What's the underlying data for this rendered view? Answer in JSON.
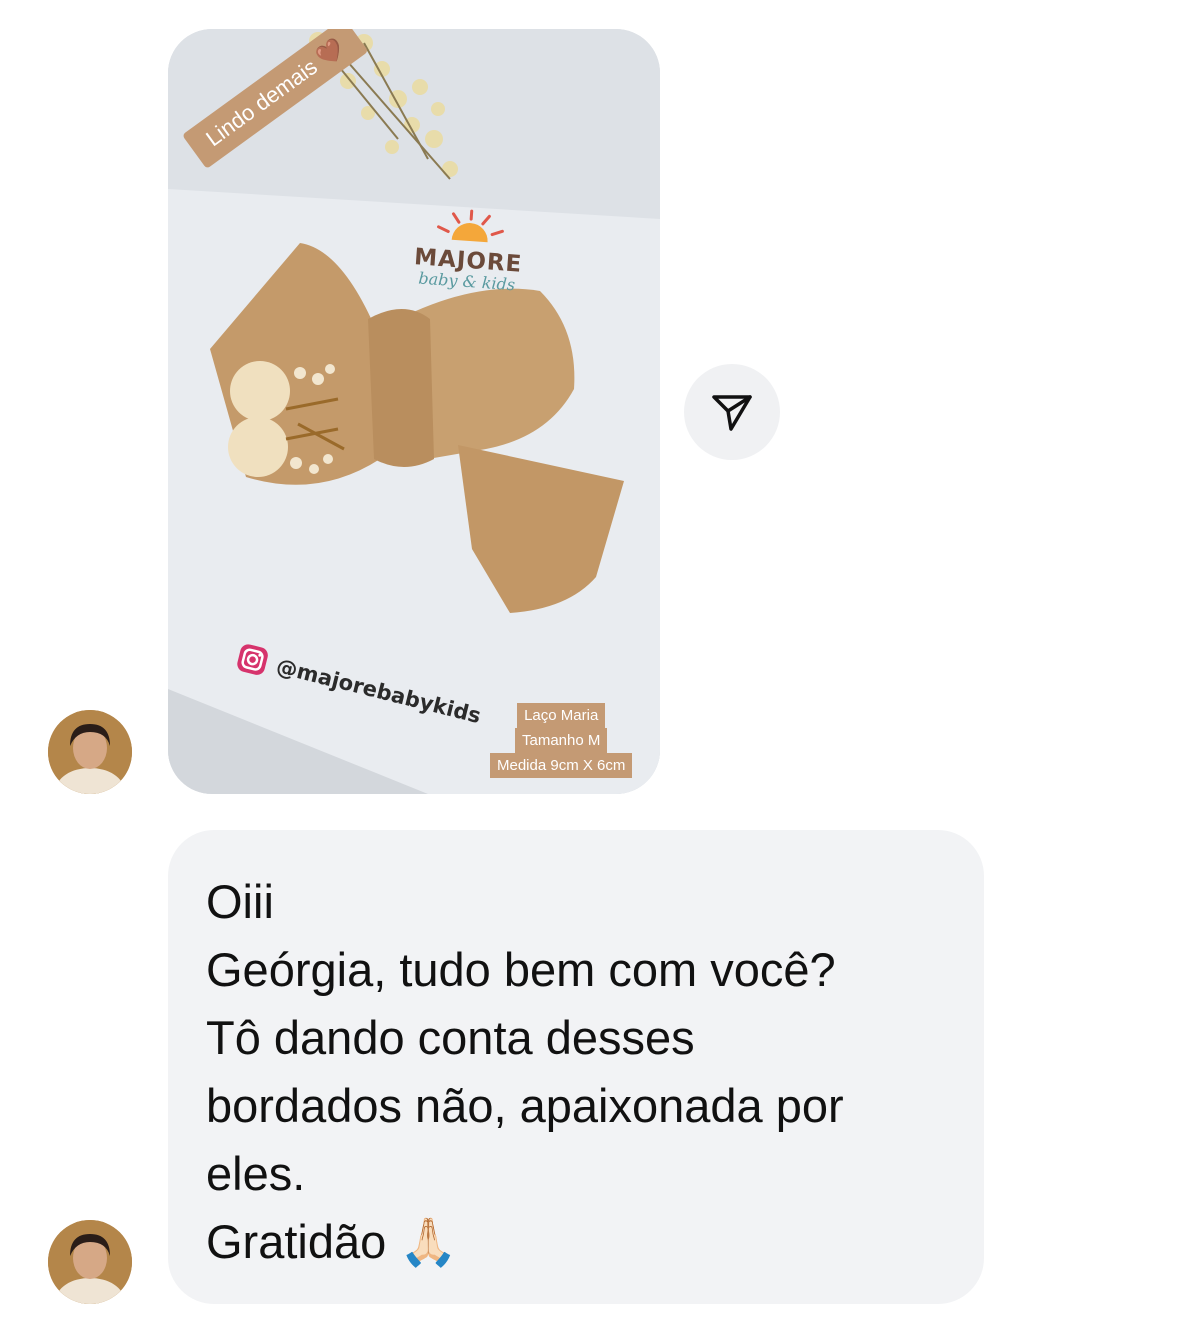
{
  "story": {
    "sticker_text": "Lindo demais 🤎",
    "brand_name": "MAJORE",
    "brand_sub": "baby & kids",
    "handle": "@majorebabykids",
    "caption_lines": [
      "Laço Maria",
      "Tamanho M",
      "Medida 9cm X 6cm"
    ]
  },
  "icons": {
    "share": "paper-plane-icon",
    "instagram": "instagram-icon"
  },
  "message": {
    "lines": [
      "Oiii",
      "Geórgia, tudo bem com você?",
      "Tô dando conta desses",
      "bordados não, apaixonada por",
      "eles.",
      "Gratidão 🙏🏻"
    ]
  },
  "colors": {
    "bubble": "#f2f3f5",
    "sticker": "#c49a74",
    "bow": "#c49a6a"
  }
}
